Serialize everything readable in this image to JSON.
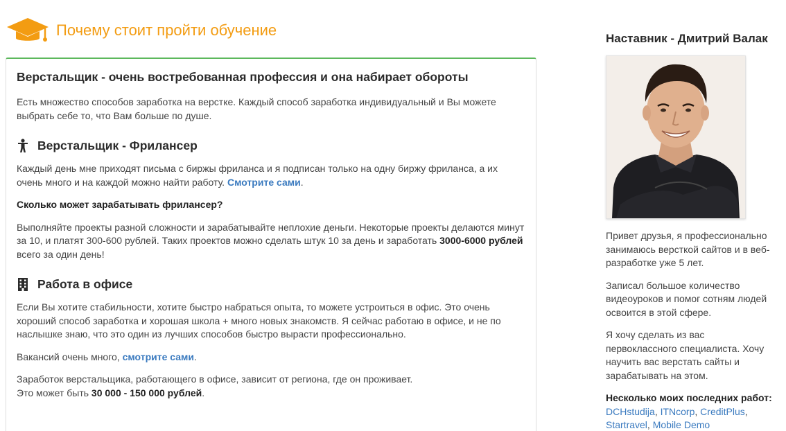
{
  "header": {
    "title": "Почему стоит пройти обучение",
    "icon": "graduation-cap-icon",
    "title_color": "#f39c12"
  },
  "main": {
    "heading": "Верстальщик - очень востребованная профессия и она набирает обороты",
    "intro": "Есть множество способов заработка на верстке. Каждый способ заработка индивидуальный и Вы можете выбрать себе то, что Вам больше по душе.",
    "freelance": {
      "icon": "person-icon",
      "heading": "Верстальщик - Фрилансер",
      "para1": "Каждый день мне приходят письма с биржы фриланса и я подписан только на одну биржу фриланса, а их очень много и на каждой можно найти работу.",
      "link_text": "Смотрите сами",
      "para1_end": ".",
      "question": "Сколько может зарабатывать фрилансер?",
      "para2": "Выполняйте проекты разной сложности и зарабатывайте неплохие деньги. Некоторые проекты делаются минут за 10, и платят 300-600 рублей. Таких проектов можно сделать штук 10 за день и заработать",
      "para2_bold": "3000-6000 рублей",
      "para2_end": "всего за один день!"
    },
    "office": {
      "icon": "office-building-icon",
      "heading": "Работа в офисе",
      "para1": "Если Вы хотите стабильности, хотите быстро набраться опыта, то можете устроиться в офис. Это очень хороший способ заработка и хорошая школа + много новых знакомств. Я сейчас работаю в офисе, и не по наслышке знаю, что это один из лучших способов быстро вырасти профессионально.",
      "vacancies": "Вакансий очень много,",
      "link_text": "смотрите сами",
      "vacancies_end": ".",
      "salary_line1": "Заработок верстальщика, работающего в офисе, зависит от региона, где он проживает.",
      "salary_line2": "Это может быть",
      "salary_bold": "30 000 - 150 000 рублей",
      "salary_end": "."
    },
    "accent_border": "#5cb85c",
    "link_color": "#3a7abf"
  },
  "sidebar": {
    "title": "Наставник - Дмитрий Валак",
    "photo": "mentor-photo",
    "para1": "Привет друзья, я профессионально занимаюсь версткой сайтов и в веб-разработке уже 5 лет.",
    "para2": "Записал большое количество видеоуроков и помог сотням людей освоится в этой сфере.",
    "para3": "Я хочу сделать из вас первоклассного специалиста. Хочу научить вас верстать сайты и зарабатывать на этом.",
    "works_title": "Несколько моих последних работ:",
    "works": [
      {
        "label": "DCHstudija",
        "sep": ", "
      },
      {
        "label": "ITNcorp",
        "sep": ", "
      },
      {
        "label": "CreditPlus",
        "sep": ","
      },
      {
        "label": "Startravel",
        "sep": ", "
      },
      {
        "label": "Mobile Demo",
        "sep": ""
      }
    ]
  }
}
